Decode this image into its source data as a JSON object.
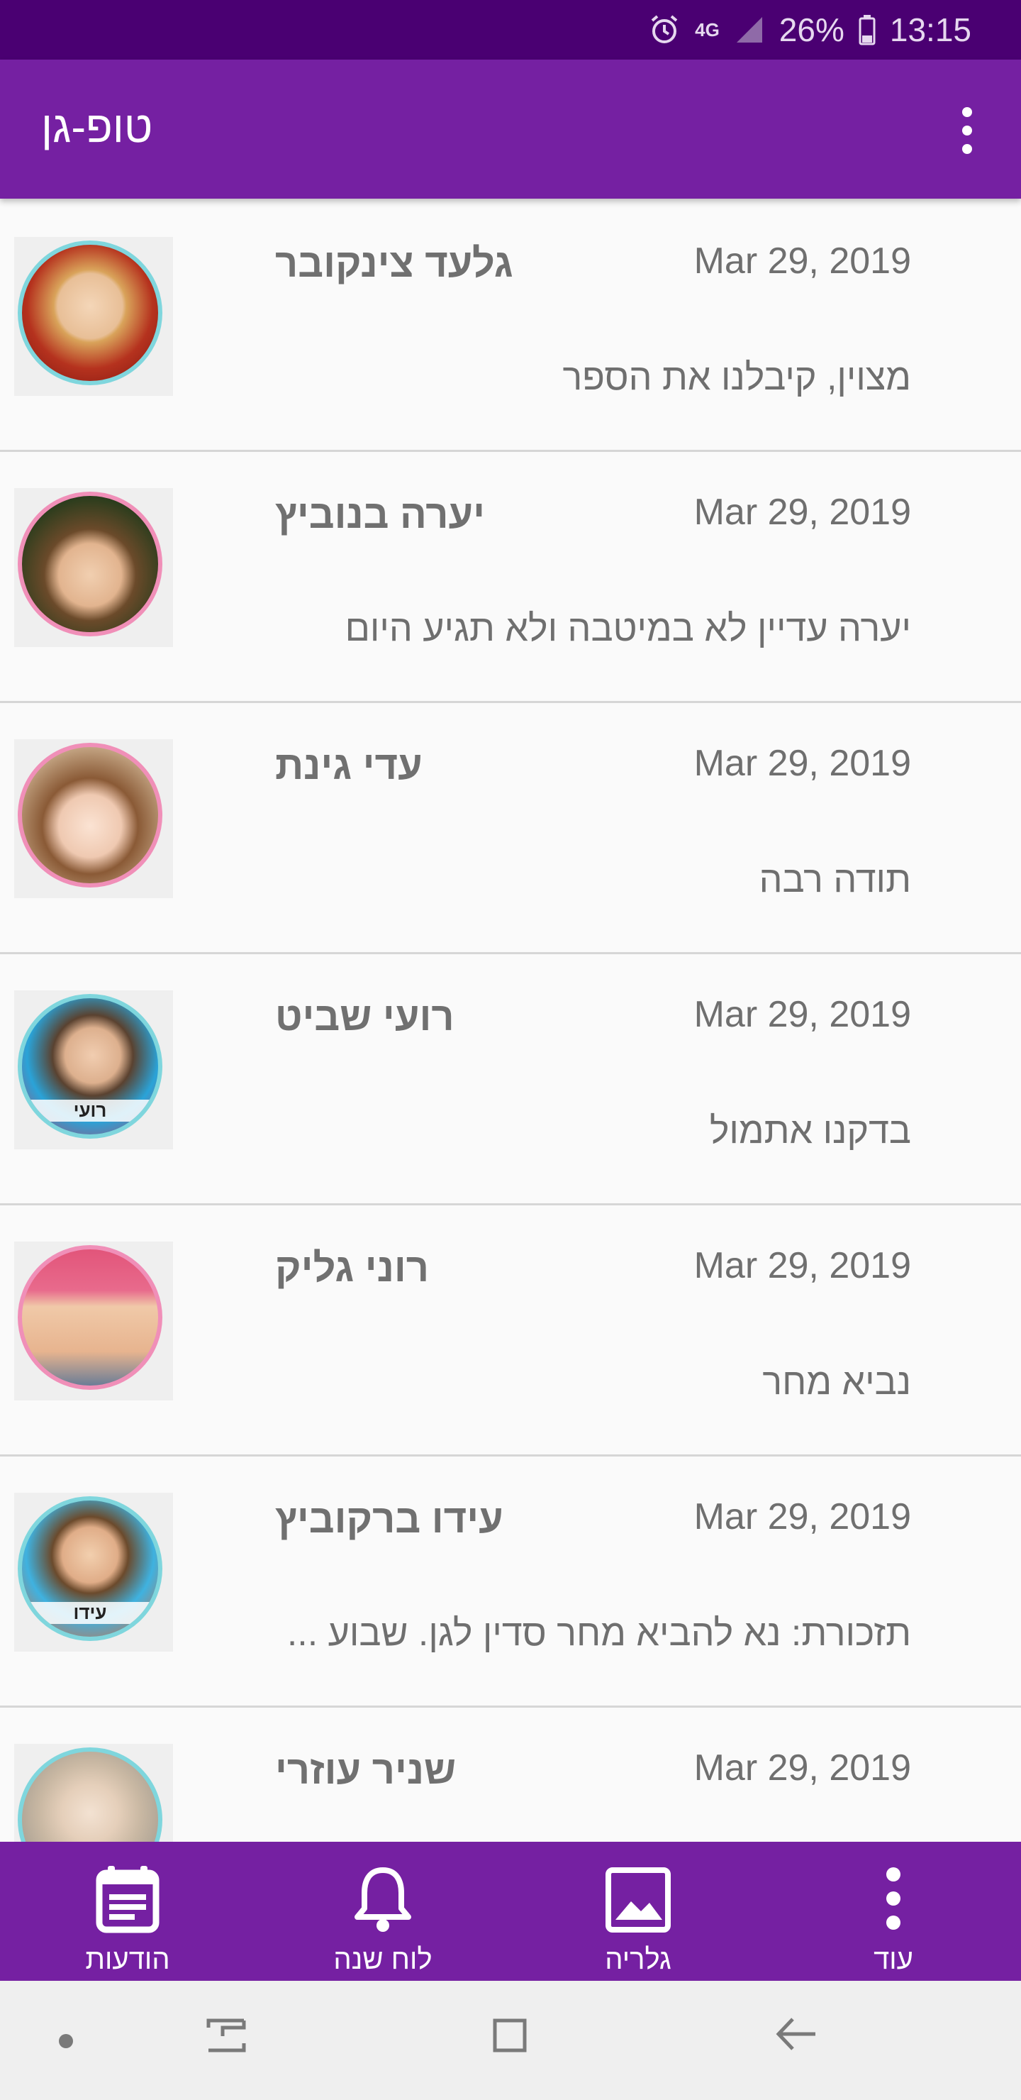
{
  "status_bar": {
    "network": "4G",
    "battery": "26%",
    "time": "13:15"
  },
  "app_bar": {
    "title": "טופ-גן"
  },
  "messages": [
    {
      "name": "גלעד צינקובר",
      "date": "Mar 29, 2019",
      "message": "מצוין, קיבלנו את הספר"
    },
    {
      "name": "יערה בנוביץ",
      "date": "Mar 29, 2019",
      "message": "יערה עדיין לא במיטבה ולא תגיע היום"
    },
    {
      "name": "עדי גינת",
      "date": "Mar 29, 2019",
      "message": "תודה רבה"
    },
    {
      "name": "רועי שביט",
      "date": "Mar 29, 2019",
      "message": "בדקנו אתמול",
      "avatar_tag": "רועי"
    },
    {
      "name": "רוני גליק",
      "date": "Mar 29, 2019",
      "message": "נביא מחר"
    },
    {
      "name": "עידו ברקוביץ",
      "date": "Mar 29, 2019",
      "message": "תזכורת: נא להביא מחר סדין לגן. שבוע ...",
      "avatar_tag": "עידו"
    },
    {
      "name": "שניר עוזרי",
      "date": "Mar 29, 2019",
      "message": ""
    }
  ],
  "bottom_nav": {
    "items": [
      {
        "label": "הודעות",
        "icon": "messages-calendar-icon"
      },
      {
        "label": "לוח שנה",
        "icon": "bell-icon"
      },
      {
        "label": "גלריה",
        "icon": "gallery-icon"
      },
      {
        "label": "עוד",
        "icon": "more-vertical-icon"
      }
    ]
  },
  "colors": {
    "status_bar": "#4a0072",
    "app_bar": "#7520a2",
    "avatar_ring_blue": "#7fd6dd",
    "avatar_ring_pink": "#f08fb8"
  }
}
